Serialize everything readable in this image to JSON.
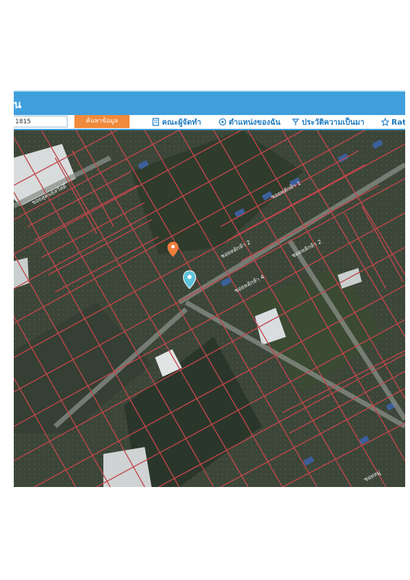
{
  "header": {
    "title": "น"
  },
  "search": {
    "value": "1815",
    "button_label": "ค้นหาข้อมูล"
  },
  "menu": [
    {
      "label": "คณะผู้จัดทำ",
      "icon": "building-icon"
    },
    {
      "label": "ตำแหน่งของฉัน",
      "icon": "location-target-icon"
    },
    {
      "label": "ประวัติความเป็นมา",
      "icon": "history-icon"
    },
    {
      "label": "Rat",
      "icon": "rating-icon"
    }
  ],
  "map": {
    "road_labels": [
      "ซอยสุคนธ์สวัสดิ์",
      "ซอยหลักห้า 2",
      "ซอยหลักห้า 4",
      "ซอยหลักห้า 1",
      "ซอยหลักห้า 2",
      "ซอยหมู่"
    ],
    "parcel_line_color": "#c2464c",
    "markers": [
      {
        "name": "orange-pin",
        "color": "#f07d3c"
      },
      {
        "name": "teal-pin",
        "color": "#5ec3d8"
      }
    ]
  }
}
